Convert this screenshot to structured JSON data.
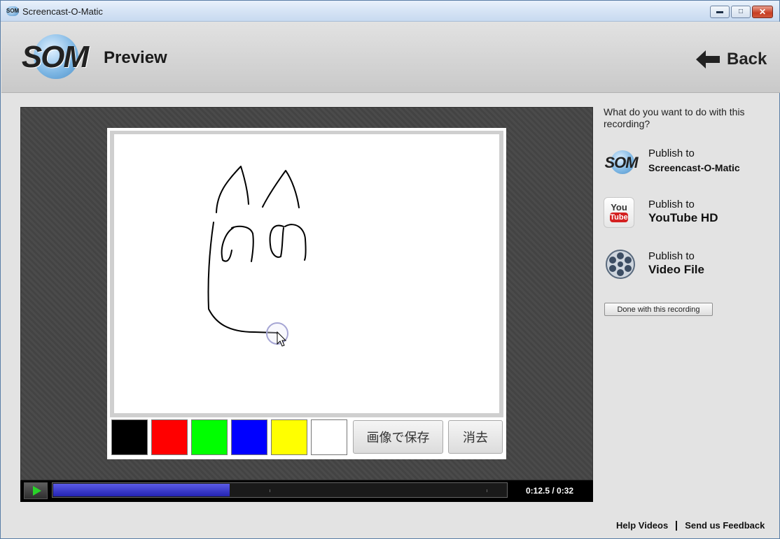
{
  "window": {
    "title": "Screencast-O-Matic",
    "icon": "som-app-icon",
    "controls": {
      "minimize": "minimize-icon",
      "maximize": "maximize-icon",
      "close": "close-icon"
    }
  },
  "header": {
    "logo_text": "SOM",
    "title": "Preview",
    "back_label": "Back"
  },
  "paint_app": {
    "colors": [
      "#000000",
      "#ff0000",
      "#00ff00",
      "#0000ff",
      "#ffff00",
      "#ffffff"
    ],
    "save_label": "画像で保存",
    "clear_label": "消去"
  },
  "player": {
    "current_time": "0:12.5",
    "total_time": "0:32",
    "time_display": "0:12.5 / 0:32",
    "progress": 0.39
  },
  "panel": {
    "question": "What do you want to do with this recording?",
    "options": [
      {
        "line1": "Publish to",
        "line2": "Screencast-O-Matic",
        "icon": "som-icon"
      },
      {
        "line1": "Publish to",
        "line2": "YouTube HD",
        "icon": "youtube-icon",
        "icon_text_top": "You",
        "icon_text_bottom": "Tube"
      },
      {
        "line1": "Publish to",
        "line2": "Video File",
        "icon": "film-reel-icon"
      }
    ],
    "done_label": "Done with this recording"
  },
  "footer": {
    "help_label": "Help Videos",
    "feedback_label": "Send us Feedback"
  }
}
